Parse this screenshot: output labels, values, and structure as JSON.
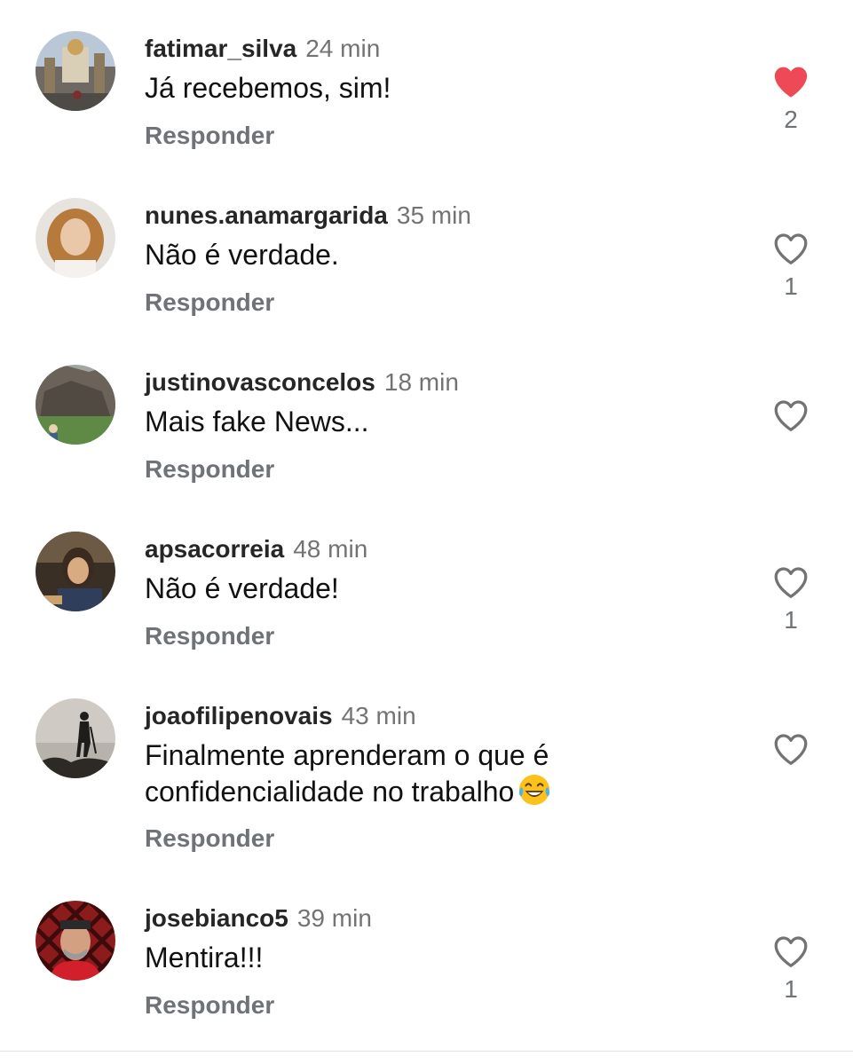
{
  "comments": [
    {
      "username": "fatimar_silva",
      "time": "24 min",
      "text": "Já recebemos, sim!",
      "reply_label": "Responder",
      "liked": true,
      "like_count": "2",
      "like_icon": "heart-filled-icon"
    },
    {
      "username": "nunes.anamargarida",
      "time": "35 min",
      "text": "Não é verdade.",
      "reply_label": "Responder",
      "liked": false,
      "like_count": "1",
      "like_icon": "heart-outline-icon"
    },
    {
      "username": "justinovasconcelos",
      "time": "18 min",
      "text": "Mais fake News...",
      "reply_label": "Responder",
      "liked": false,
      "like_count": "",
      "like_icon": "heart-outline-icon"
    },
    {
      "username": "apsacorreia",
      "time": "48 min",
      "text": "Não é verdade!",
      "reply_label": "Responder",
      "liked": false,
      "like_count": "1",
      "like_icon": "heart-outline-icon"
    },
    {
      "username": "joaofilipenovais",
      "time": "43 min",
      "text": "Finalmente aprenderam o que é confidencialidade no trabalho",
      "emoji": "face-with-tears-of-joy-icon",
      "reply_label": "Responder",
      "liked": false,
      "like_count": "",
      "like_icon": "heart-outline-icon"
    },
    {
      "username": "josebianco5",
      "time": "39 min",
      "text": "Mentira!!!",
      "reply_label": "Responder",
      "liked": false,
      "like_count": "1",
      "like_icon": "heart-outline-icon"
    }
  ],
  "colors": {
    "like_active": "#ed4956",
    "muted_text": "#6f7378",
    "username": "#262626"
  }
}
